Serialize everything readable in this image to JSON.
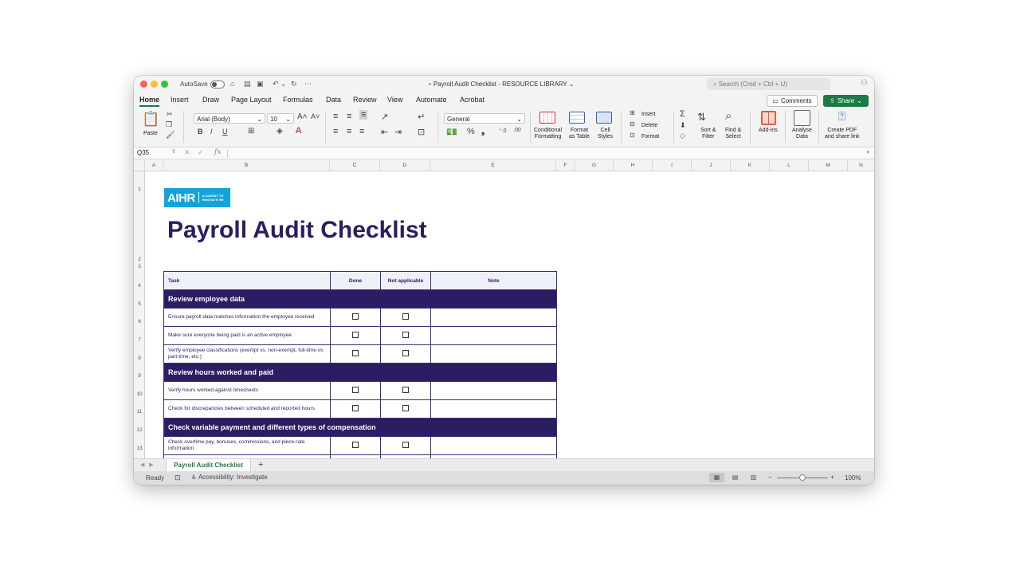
{
  "window": {
    "autosave_label": "AutoSave",
    "title": "Payroll Audit Checklist - RESOURCE LIBRARY",
    "title_caret": "⌄",
    "search_placeholder": "Search (Cmd + Ctrl + U)"
  },
  "tabs": [
    "Home",
    "Insert",
    "Draw",
    "Page Layout",
    "Formulas",
    "Data",
    "Review",
    "View",
    "Automate",
    "Acrobat"
  ],
  "buttons": {
    "comments": "Comments",
    "share": "Share"
  },
  "ribbon": {
    "paste": "Paste",
    "font_name": "Arial (Body)",
    "font_size": "10",
    "bold": "B",
    "italic": "I",
    "underline": "U",
    "number_format": "General",
    "conditional_formatting": "Conditional\nFormatting",
    "format_as_table": "Format\nas Table",
    "cell_styles": "Cell\nStyles",
    "insert": "Insert",
    "delete": "Delete",
    "format": "Format",
    "sort_filter": "Sort &\nFilter",
    "find_select": "Find &\nSelect",
    "add_ins": "Add-ins",
    "analyse_data": "Analyse\nData",
    "create_pdf": "Create PDF\nand share link"
  },
  "formula_bar": {
    "name_box": "Q35",
    "fx": "fx",
    "value": ""
  },
  "columns": [
    "A",
    "B",
    "C",
    "D",
    "E",
    "F",
    "G",
    "H",
    "I",
    "J",
    "K",
    "L",
    "M",
    "N"
  ],
  "rows": [
    "1",
    "2",
    "3",
    "4",
    "5",
    "6",
    "7",
    "8",
    "9",
    "10",
    "11",
    "12",
    "13"
  ],
  "logo": {
    "main": "AIHR",
    "sub": "ACADEMY TO INNOVATE HR"
  },
  "sheet_title": "Payroll Audit Checklist",
  "table": {
    "headers": [
      "Task",
      "Done",
      "Not applicable",
      "Note"
    ],
    "sections": [
      {
        "title": "Review employee data",
        "items": [
          "Ensure payroll data matches information the employee received",
          "Make sure everyone being paid is an active employee",
          "Verify employee classifications (exempt vs. non-exempt, full-time vs. part-time, etc.)"
        ]
      },
      {
        "title": "Review hours worked and paid",
        "items": [
          "Verify hours worked against timesheets",
          "Check for discrepancies between scheduled and reported hours"
        ]
      },
      {
        "title": "Check variable payment and different types of compensation",
        "items": [
          "Check overtime pay, bonuses, commissions, and piece-rate information",
          ""
        ]
      }
    ]
  },
  "sheet_tabs": {
    "active": "Payroll Audit Checklist",
    "add": "+"
  },
  "status": {
    "ready": "Ready",
    "accessibility": "Accessibility: Investigate",
    "zoom": "100%"
  },
  "colors": {
    "accent": "#1d7a45",
    "brand": "#2b1c63",
    "logo": "#12a3d9"
  }
}
